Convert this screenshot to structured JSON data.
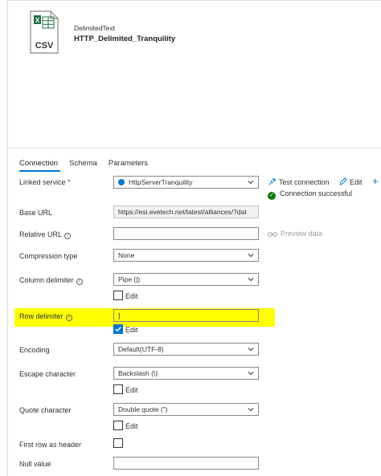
{
  "header": {
    "icon_label": "CSV",
    "dataset_type": "DelimitedText",
    "dataset_name": "HTTP_Delimited_Tranquility"
  },
  "tabs": [
    {
      "label": "Connection",
      "active": true
    },
    {
      "label": "Schema",
      "active": false
    },
    {
      "label": "Parameters",
      "active": false
    }
  ],
  "linked_service": {
    "label": "Linked service",
    "required_mark": "*",
    "value": "HttpServerTranquility",
    "test_connection": "Test connection",
    "edit": "Edit",
    "new": "+",
    "status": "Connection successful"
  },
  "base_url": {
    "label": "Base URL",
    "value": "https://esi.evetech.net/latest/alliances/?dat"
  },
  "relative_url": {
    "label": "Relative URL",
    "value": "",
    "preview": "Preview data"
  },
  "compression_type": {
    "label": "Compression type",
    "value": "None"
  },
  "column_delimiter": {
    "label": "Column delimiter",
    "value": "Pipe (|)",
    "edit_label": "Edit",
    "edit_checked": false
  },
  "row_delimiter": {
    "label": "Row delimiter",
    "value": "]",
    "edit_label": "Edit",
    "edit_checked": true
  },
  "encoding": {
    "label": "Encoding",
    "value": "Default(UTF-8)"
  },
  "escape_character": {
    "label": "Escape character",
    "value": "Backslash (\\)",
    "edit_label": "Edit",
    "edit_checked": false
  },
  "quote_character": {
    "label": "Quote character",
    "value": "Double quote (\")",
    "edit_label": "Edit",
    "edit_checked": false
  },
  "first_row_header": {
    "label": "First row as header",
    "checked": false
  },
  "null_value": {
    "label": "Null value",
    "value": ""
  },
  "colors": {
    "accent": "#0078d4",
    "success": "#107c10",
    "highlight": "#ffff00",
    "csv_green": "#217346"
  }
}
